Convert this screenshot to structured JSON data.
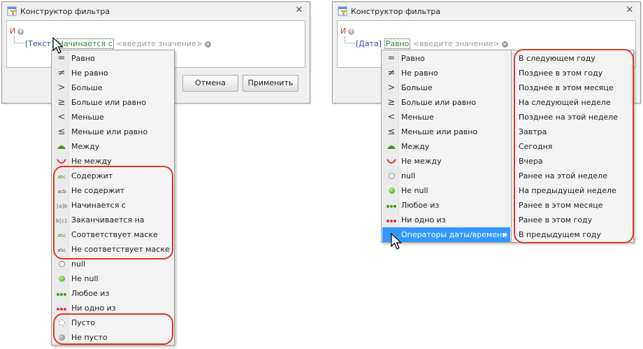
{
  "left_window": {
    "title": "Конструктор фильтра",
    "logic_operator": "И",
    "condition": {
      "field": "[Текст]",
      "operator": "Начинается с",
      "value_placeholder": "<введите значение>"
    },
    "buttons": {
      "cancel": "Отмена",
      "apply": "Применить"
    },
    "menu_items": [
      {
        "label": "Равно",
        "icon": "equals-icon"
      },
      {
        "label": "Не равно",
        "icon": "not-equals-icon"
      },
      {
        "label": "Больше",
        "icon": "greater-icon"
      },
      {
        "label": "Больше или равно",
        "icon": "greater-equal-icon"
      },
      {
        "label": "Меньше",
        "icon": "less-icon"
      },
      {
        "label": "Меньше или равно",
        "icon": "less-equal-icon"
      },
      {
        "label": "Между",
        "icon": "between-icon"
      },
      {
        "label": "Не между",
        "icon": "not-between-icon"
      },
      {
        "label": "Содержит",
        "icon": "contains-icon"
      },
      {
        "label": "Не содержит",
        "icon": "not-contains-icon"
      },
      {
        "label": "Начинается с",
        "icon": "begins-with-icon"
      },
      {
        "label": "Заканчивается на",
        "icon": "ends-with-icon"
      },
      {
        "label": "Соответствует маске",
        "icon": "like-icon"
      },
      {
        "label": "Не соответствует маске",
        "icon": "not-like-icon"
      },
      {
        "label": "null",
        "icon": "null-icon"
      },
      {
        "label": "Не null",
        "icon": "not-null-icon"
      },
      {
        "label": "Любое из",
        "icon": "any-of-icon"
      },
      {
        "label": "Ни одно из",
        "icon": "none-of-icon"
      },
      {
        "label": "Пусто",
        "icon": "empty-icon"
      },
      {
        "label": "Не пусто",
        "icon": "not-empty-icon"
      }
    ]
  },
  "right_window": {
    "title": "Конструктор фильтра",
    "logic_operator": "И",
    "condition": {
      "field": "[Дата]",
      "operator": "Равно",
      "value_placeholder": "<введите значение>"
    },
    "menu_items": [
      {
        "label": "Равно",
        "icon": "equals-icon"
      },
      {
        "label": "Не равно",
        "icon": "not-equals-icon"
      },
      {
        "label": "Больше",
        "icon": "greater-icon"
      },
      {
        "label": "Больше или равно",
        "icon": "greater-equal-icon"
      },
      {
        "label": "Меньше",
        "icon": "less-icon"
      },
      {
        "label": "Меньше или равно",
        "icon": "less-equal-icon"
      },
      {
        "label": "Между",
        "icon": "between-icon"
      },
      {
        "label": "Не между",
        "icon": "not-between-icon"
      },
      {
        "label": "null",
        "icon": "null-icon"
      },
      {
        "label": "Не null",
        "icon": "not-null-icon"
      },
      {
        "label": "Любое из",
        "icon": "any-of-icon"
      },
      {
        "label": "Ни одно из",
        "icon": "none-of-icon"
      },
      {
        "label": "Операторы даты/времени",
        "icon": "",
        "highlighted": true,
        "has_submenu": true
      }
    ],
    "submenu_items": [
      "В следующем году",
      "Позднее в этом году",
      "Позднее в этом месяце",
      "На следующей неделе",
      "Позднее на этой неделе",
      "Завтра",
      "Сегодня",
      "Вчера",
      "Ранее на этой неделе",
      "На предыдущей неделе",
      "Ранее в этом месяце",
      "Ранее в этом году",
      "В предыдущем году"
    ]
  },
  "colors": {
    "highlight": "#3399ff",
    "annotation": "#e23a1f",
    "field": "#2c4fae",
    "operator": "#2d8a2d",
    "logic": "#c0392b"
  }
}
